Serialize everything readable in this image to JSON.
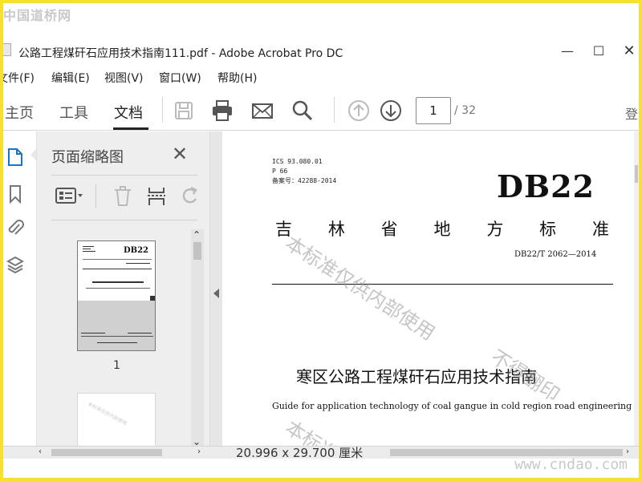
{
  "watermark": {
    "top_left": "中国道桥网",
    "bottom_right": "www.cndao.com",
    "page_overlay": [
      "本标准仅供内部使用",
      "不得翻印",
      "本标准"
    ]
  },
  "window": {
    "title": "公路工程煤矸石应用技术指南111.pdf - Adobe Acrobat Pro DC",
    "minimize": "—",
    "maximize": "☐",
    "close": "✕"
  },
  "menu": [
    "文件(F)",
    "编辑(E)",
    "视图(V)",
    "窗口(W)",
    "帮助(H)"
  ],
  "toolbar": {
    "tabs": [
      {
        "label": "主页",
        "active": false
      },
      {
        "label": "工具",
        "active": false
      },
      {
        "label": "文档",
        "active": true
      }
    ],
    "page_current": "1",
    "page_total": "/ 32",
    "login": "登录"
  },
  "panel": {
    "title": "页面缩略图",
    "thumbnail_label": "1"
  },
  "document": {
    "ics": "ICS 93.080.01",
    "p": "P 66",
    "record": "备案号：42288-2014",
    "brand": "DB22",
    "standard_chars": [
      "吉",
      "林",
      "省",
      "地",
      "方",
      "标",
      "准"
    ],
    "number": "DB22/T 2062—2014",
    "title_cn": "寒区公路工程煤矸石应用技术指南",
    "title_en": "Guide for application technology of coal gangue in cold region road engineering"
  },
  "status": {
    "page_size": "20.996 x 29.700 厘米"
  },
  "colors": {
    "frame": "#f8e030",
    "accent": "#222222",
    "panel_bg": "#eeeeee"
  }
}
